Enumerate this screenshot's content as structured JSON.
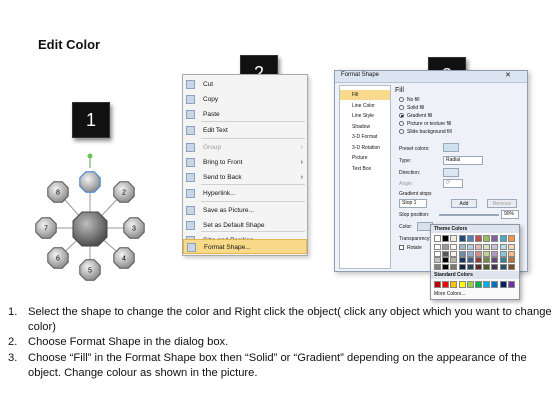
{
  "title": "Edit Color",
  "badges": [
    "1",
    "2",
    "3"
  ],
  "diagram": {
    "nodes": [
      "8",
      "",
      "2",
      "7",
      "3",
      "6",
      "4",
      "5"
    ]
  },
  "context_menu": {
    "items": [
      {
        "label": "Cut",
        "enabled": true
      },
      {
        "label": "Copy",
        "enabled": true
      },
      {
        "label": "Paste",
        "enabled": true
      },
      {
        "label": "Edit Text",
        "enabled": true
      },
      {
        "label": "Group",
        "enabled": false
      },
      {
        "label": "Bring to Front",
        "enabled": true
      },
      {
        "label": "Send to Back",
        "enabled": true
      },
      {
        "label": "Hyperlink...",
        "enabled": true
      },
      {
        "label": "Save as Picture...",
        "enabled": true
      },
      {
        "label": "Set as Default Shape",
        "enabled": true
      },
      {
        "label": "Size and Position...",
        "enabled": true
      },
      {
        "label": "Format Shape...",
        "enabled": true,
        "highlighted": true
      }
    ]
  },
  "format_dialog": {
    "title": "Format Shape",
    "categories": [
      "Fill",
      "Line Color",
      "Line Style",
      "Shadow",
      "3-D Format",
      "3-D Rotation",
      "Picture",
      "Text Box"
    ],
    "pane_title": "Fill",
    "fill_options": [
      "No fill",
      "Solid fill",
      "Gradient fill",
      "Picture or texture fill",
      "Slide background fill"
    ],
    "selected_fill": "Gradient fill",
    "preset_label": "Preset colors:",
    "type_label": "Type:",
    "type_value": "Radial",
    "direction_label": "Direction:",
    "angle_label": "Angle:",
    "angle_value": "0°",
    "gradient_stops_label": "Gradient stops",
    "stop_value": "Stop 1",
    "add_button": "Add",
    "remove_button": "Remove",
    "stop_position_label": "Stop position:",
    "stop_position_value": "90%",
    "color_label": "Color:",
    "transparency_label": "Transparency:",
    "rotate_label": "Rotate"
  },
  "palette": {
    "theme_label": "Theme Colors",
    "standard_label": "Standard Colors",
    "more_label": "More Colors...",
    "theme_top": [
      "#ffffff",
      "#000000",
      "#eeece1",
      "#1f497d",
      "#4f81bd",
      "#c0504d",
      "#9bbb59",
      "#8064a2",
      "#4bacc6",
      "#f79646"
    ],
    "standard": [
      "#c00000",
      "#ff0000",
      "#ffc000",
      "#ffff00",
      "#92d050",
      "#00b050",
      "#00b0f0",
      "#0070c0",
      "#002060",
      "#7030a0"
    ]
  },
  "steps": [
    {
      "num": "1.",
      "text": "Select the shape to change the color and Right click the object( click any object which you want to change color)"
    },
    {
      "num": "2.",
      "text": "Choose Format Shape in the dialog box."
    },
    {
      "num": "3.",
      "text": "Choose “Fill” in the Format Shape box then “Solid” or “Gradient” depending on the appearance of the object. Change colour as shown in the picture."
    }
  ]
}
